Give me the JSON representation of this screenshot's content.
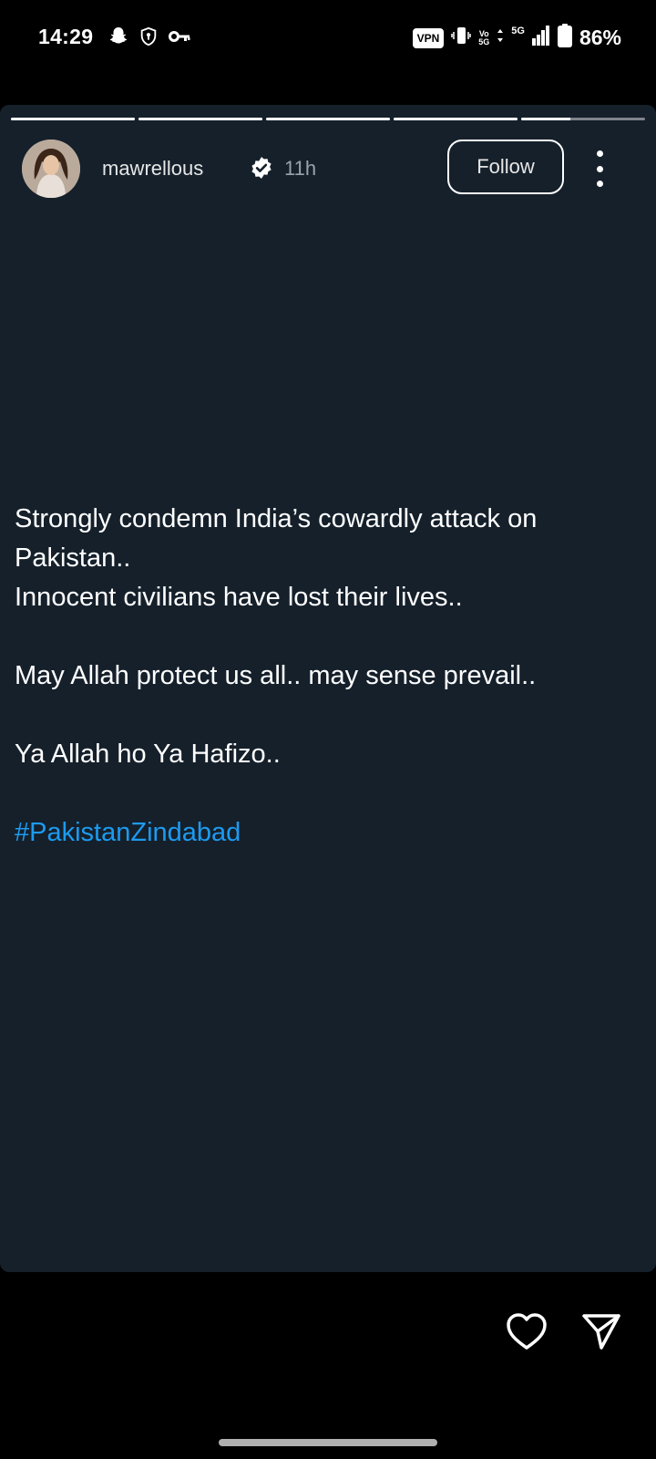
{
  "status_bar": {
    "time": "14:29",
    "left_icons": [
      "snapchat-icon",
      "shield-icon",
      "key-icon"
    ],
    "vpn_label": "VPN",
    "volte_label_top": "Vo",
    "volte_label_bottom": "5G",
    "network_label": "5G",
    "battery_percent": "86%"
  },
  "story": {
    "progress_segments": [
      1.0,
      1.0,
      1.0,
      1.0,
      0.4
    ],
    "username": "mawrellous",
    "verified": true,
    "time_ago": "11h",
    "follow_label": "Follow",
    "lines": {
      "l1": "Strongly condemn India’s cowardly attack on",
      "l2": "Pakistan..",
      "l3": "Innocent civilians have lost their lives..",
      "l4": "May Allah protect us all.. may sense prevail..",
      "l5": "Ya Allah ho Ya Hafizo..",
      "hashtag": "#PakistanZindabad"
    },
    "colors": {
      "card_background": "#15202b",
      "hashtag": "#1d9bf0"
    }
  },
  "actions": {
    "like_icon": "heart-icon",
    "share_icon": "send-icon"
  }
}
